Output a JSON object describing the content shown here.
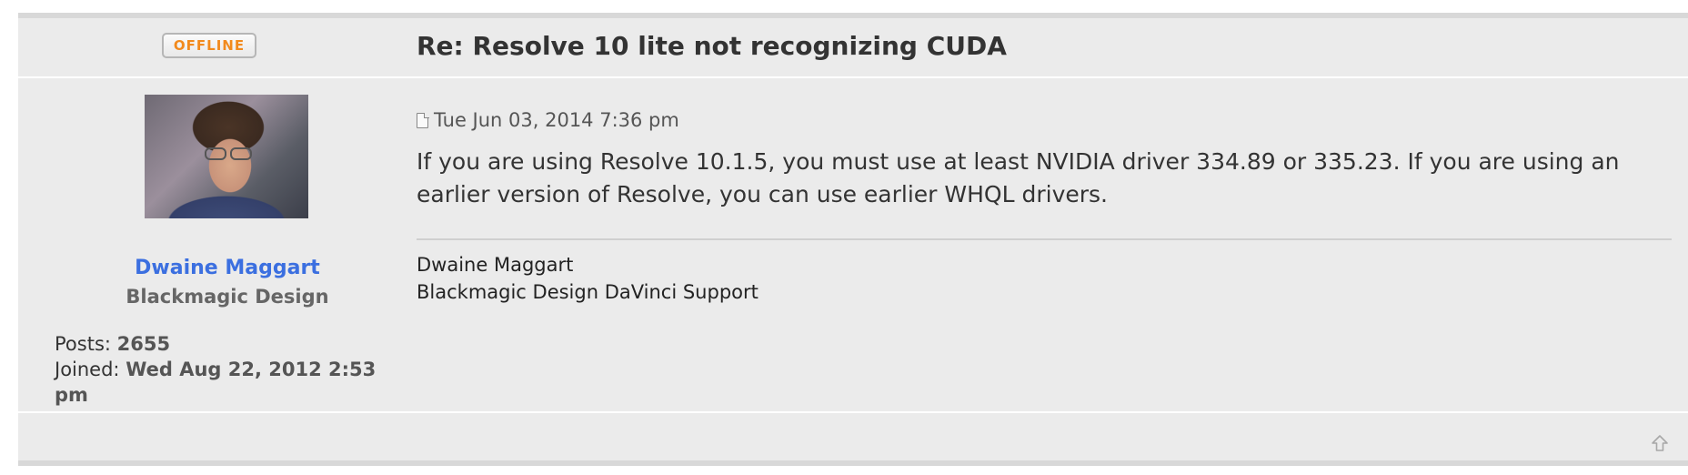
{
  "post": {
    "status_badge": "OFFLINE",
    "title": "Re: Resolve 10 lite not recognizing CUDA",
    "timestamp": "Tue Jun 03, 2014 7:36 pm",
    "content": "If you are using Resolve 10.1.5, you must use at least NVIDIA driver 334.89 or 335.23. If you are using an earlier version of Resolve, you can use earlier WHQL drivers.",
    "signature": {
      "line1": "Dwaine Maggart",
      "line2": "Blackmagic Design DaVinci Support"
    }
  },
  "author": {
    "name": "Dwaine Maggart",
    "rank": "Blackmagic Design",
    "posts_label": "Posts:",
    "posts_value": "2655",
    "joined_label": "Joined:",
    "joined_value": "Wed Aug 22, 2012 2:53 pm"
  },
  "icons": {
    "post_icon": "file-icon",
    "back_to_top": "up-arrow-icon"
  },
  "colors": {
    "username": "#3b6fe0",
    "offline": "#f28a1d",
    "panel_bg": "#ebebeb"
  }
}
